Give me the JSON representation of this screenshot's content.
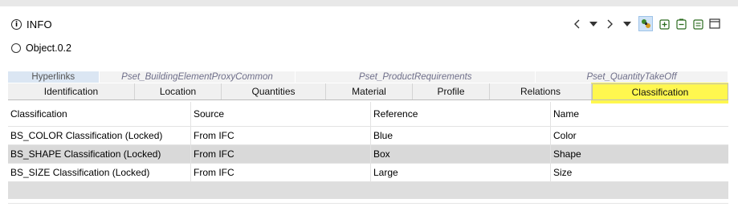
{
  "header": {
    "title": "INFO",
    "info_icon": "info-icon"
  },
  "toolbar": {
    "icons": [
      "chevron-left-icon",
      "caret-down-icon",
      "chevron-right-icon",
      "caret-down-icon",
      "link-objects-icon",
      "add-icon",
      "remove-icon",
      "edit-icon",
      "maximize-icon"
    ]
  },
  "object": {
    "label": "Object.0.2"
  },
  "tabs": {
    "back_row": [
      "Hyperlinks",
      "Pset_BuildingElementProxyCommon",
      "Pset_ProductRequirements",
      "Pset_QuantityTakeOff"
    ],
    "front_row": [
      "Identification",
      "Location",
      "Quantities",
      "Material",
      "Profile",
      "Relations",
      "Classification"
    ],
    "active": "Classification"
  },
  "table": {
    "columns": [
      "Classification",
      "Source",
      "Reference",
      "Name"
    ],
    "rows": [
      [
        "BS_COLOR Classification (Locked)",
        "From IFC",
        "Blue",
        "Color"
      ],
      [
        "BS_SHAPE Classification (Locked)",
        "From IFC",
        "Box",
        "Shape"
      ],
      [
        "BS_SIZE Classification (Locked)",
        "From IFC",
        "Large",
        "Size"
      ]
    ],
    "selected_row": 1
  },
  "colors": {
    "highlight": "#fff51e",
    "tab_back_first": "#dbe6f3",
    "selected_row": "#d9d9d9"
  }
}
